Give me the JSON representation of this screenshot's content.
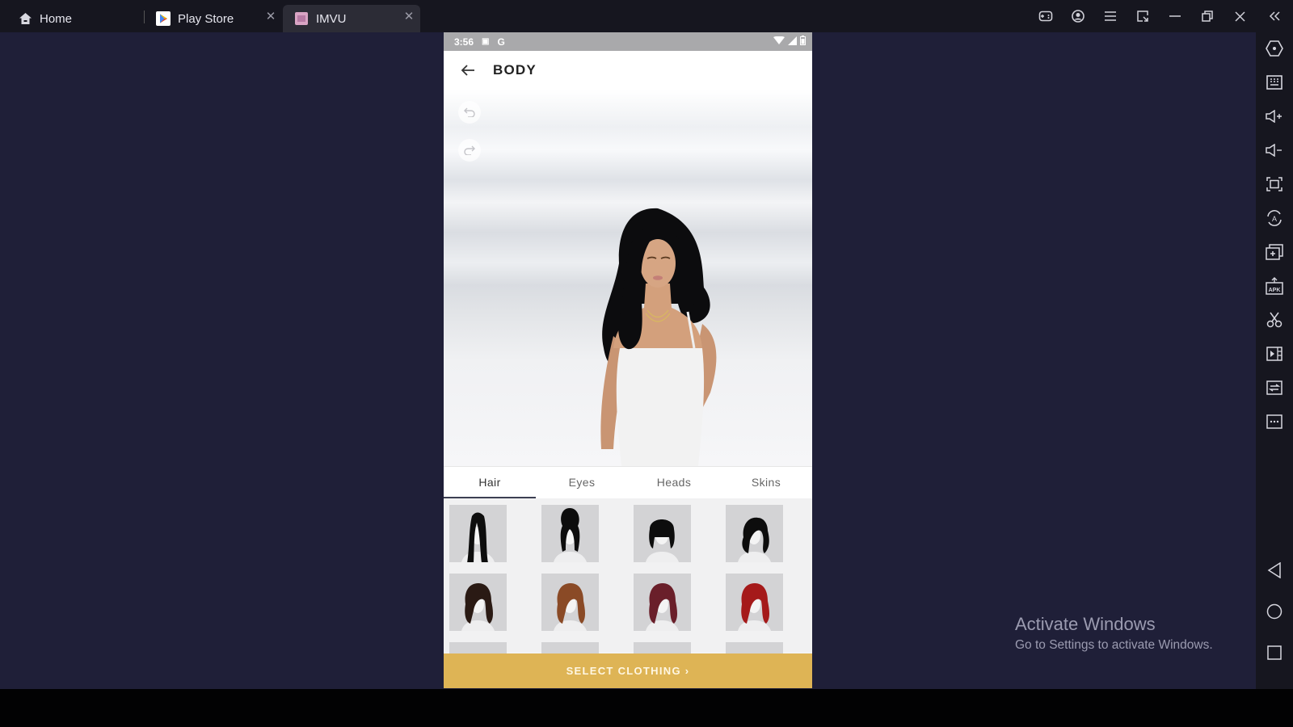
{
  "titlebar": {
    "tabs": [
      {
        "label": "Home",
        "icon": "home-icon"
      },
      {
        "label": "Play Store",
        "icon": "play-store-icon",
        "closable": true
      },
      {
        "label": "IMVU",
        "icon": "imvu-app-icon",
        "closable": true,
        "active": true
      }
    ],
    "close_glyph": "✕",
    "controls": [
      "gamepad-icon",
      "account-icon",
      "menu-icon",
      "resize-icon",
      "minimize-icon",
      "restore-icon",
      "close-icon",
      "collapse-sidebar-icon"
    ]
  },
  "sidebar": {
    "tools": [
      "settings-hexagon",
      "keyboard",
      "volume-up",
      "volume-down",
      "fullscreen",
      "auto-rotate",
      "multi-instance",
      "install-apk",
      "screenshot-scissors",
      "record-video",
      "sync",
      "more"
    ],
    "nav": [
      "back",
      "home",
      "recents"
    ]
  },
  "phone": {
    "status": {
      "time": "3:56",
      "notif_1": "▣",
      "notif_2": "G"
    },
    "appbar": {
      "title": "BODY"
    },
    "category_tabs": [
      {
        "label": "Hair",
        "active": true
      },
      {
        "label": "Eyes"
      },
      {
        "label": "Heads"
      },
      {
        "label": "Skins"
      }
    ],
    "hair_items": [
      {
        "style": "long-straight",
        "color": "#0d0d0d"
      },
      {
        "style": "beehive-updo",
        "color": "#0d0d0d"
      },
      {
        "style": "short-bob-bangs",
        "color": "#0d0d0d"
      },
      {
        "style": "side-swept-waves",
        "color": "#0d0d0d"
      },
      {
        "style": "bob-side-part",
        "color": "#2a1a14"
      },
      {
        "style": "bob-side-part",
        "color": "#8a4a26"
      },
      {
        "style": "bob-side-part",
        "color": "#6a1f2a"
      },
      {
        "style": "bob-side-part",
        "color": "#a51a1a"
      }
    ],
    "cta_label": "SELECT CLOTHING ›"
  },
  "watermark": {
    "title": "Activate Windows",
    "subtitle": "Go to Settings to activate Windows."
  }
}
